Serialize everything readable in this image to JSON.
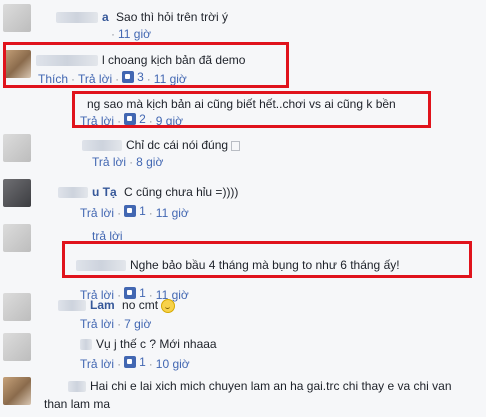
{
  "comments": [
    {
      "name": "a",
      "text": "Sao thì hỏi trên trời ý",
      "time": "11 giờ"
    },
    {
      "name": "",
      "text": "l choang kịch bản đã demo",
      "like_label": "Thích",
      "reply_label": "Trả lời",
      "likes": "3",
      "time": "11 giờ"
    },
    {
      "name": "",
      "text": "ng sao mà kịch bản ai cũng biết hết..chơi vs ai cũng k bền",
      "reply_label": "Trả lời",
      "likes": "2",
      "time": "9 giờ"
    },
    {
      "name": "",
      "text": "Chỉ dc cái nói đúng",
      "reply_label": "Trả lời",
      "time": "8 giờ"
    },
    {
      "name": "u Tạ",
      "text": "C cũng chưa hỉu =))))",
      "reply_label": "Trả lời",
      "likes": "1",
      "time": "11 giờ"
    },
    {
      "name": "",
      "text": "",
      "reply_label": "trả lời"
    },
    {
      "name": "",
      "text": "Nghe bảo bầu 4 tháng mà bụng to như 6 tháng ấy!",
      "reply_label": "Trả lời",
      "likes": "1",
      "time": "11 giờ"
    },
    {
      "name": "Lam",
      "text": "no cmt",
      "reply_label": "Trả lời",
      "time": "7 giờ"
    },
    {
      "name": "",
      "text": "Vụ j thế c ? Mới nhaaa",
      "reply_label": "Trả lời",
      "likes": "1",
      "time": "10 giờ"
    },
    {
      "name": "",
      "text": "Hai chi e lai xich mich chuyen lam an ha gai.trc chi thay e va chi van",
      "text2": "than lam ma"
    }
  ],
  "colors": {
    "accent": "#4267b2",
    "highlight": "#e0131c",
    "name": "#365899"
  }
}
